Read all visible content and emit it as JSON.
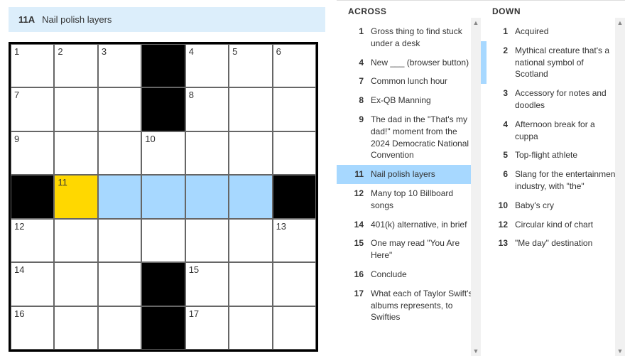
{
  "current_clue": {
    "number": "11A",
    "text": "Nail polish layers"
  },
  "grid_size": 7,
  "cells": [
    {
      "n": "1"
    },
    {
      "n": "2"
    },
    {
      "n": "3"
    },
    {
      "black": true
    },
    {
      "n": "4"
    },
    {
      "n": "5"
    },
    {
      "n": "6"
    },
    {
      "n": "7"
    },
    {},
    {},
    {
      "black": true
    },
    {
      "n": "8"
    },
    {},
    {},
    {
      "n": "9"
    },
    {},
    {},
    {
      "n": "10"
    },
    {},
    {},
    {},
    {
      "black": true
    },
    {
      "n": "11",
      "focus": true
    },
    {
      "hl": true
    },
    {
      "hl": true
    },
    {
      "hl": true
    },
    {
      "hl": true
    },
    {
      "black": true
    },
    {
      "n": "12"
    },
    {},
    {},
    {},
    {},
    {},
    {
      "n": "13"
    },
    {
      "n": "14"
    },
    {},
    {},
    {
      "black": true
    },
    {
      "n": "15"
    },
    {},
    {},
    {
      "n": "16"
    },
    {},
    {},
    {
      "black": true
    },
    {
      "n": "17"
    },
    {},
    {}
  ],
  "across_header": "ACROSS",
  "down_header": "DOWN",
  "across": [
    {
      "n": "1",
      "t": "Gross thing to find stuck under a desk"
    },
    {
      "n": "4",
      "t": "New ___ (browser button)"
    },
    {
      "n": "7",
      "t": "Common lunch hour"
    },
    {
      "n": "8",
      "t": "Ex-QB Manning"
    },
    {
      "n": "9",
      "t": "The dad in the \"That's my dad!\" moment from the 2024 Democratic National Convention"
    },
    {
      "n": "11",
      "t": "Nail polish layers",
      "active": true
    },
    {
      "n": "12",
      "t": "Many top 10 Billboard songs"
    },
    {
      "n": "14",
      "t": "401(k) alternative, in brief"
    },
    {
      "n": "15",
      "t": "One may read \"You Are Here\""
    },
    {
      "n": "16",
      "t": "Conclude"
    },
    {
      "n": "17",
      "t": "What each of Taylor Swift's albums represents, to Swifties"
    }
  ],
  "down": [
    {
      "n": "1",
      "t": "Acquired"
    },
    {
      "n": "2",
      "t": "Mythical creature that's a national symbol of Scotland",
      "rel": true
    },
    {
      "n": "3",
      "t": "Accessory for notes and doodles"
    },
    {
      "n": "4",
      "t": "Afternoon break for a cuppa"
    },
    {
      "n": "5",
      "t": "Top-flight athlete"
    },
    {
      "n": "6",
      "t": "Slang for the entertainment industry, with \"the\""
    },
    {
      "n": "10",
      "t": "Baby's cry"
    },
    {
      "n": "12",
      "t": "Circular kind of chart"
    },
    {
      "n": "13",
      "t": "\"Me day\" destination"
    }
  ]
}
